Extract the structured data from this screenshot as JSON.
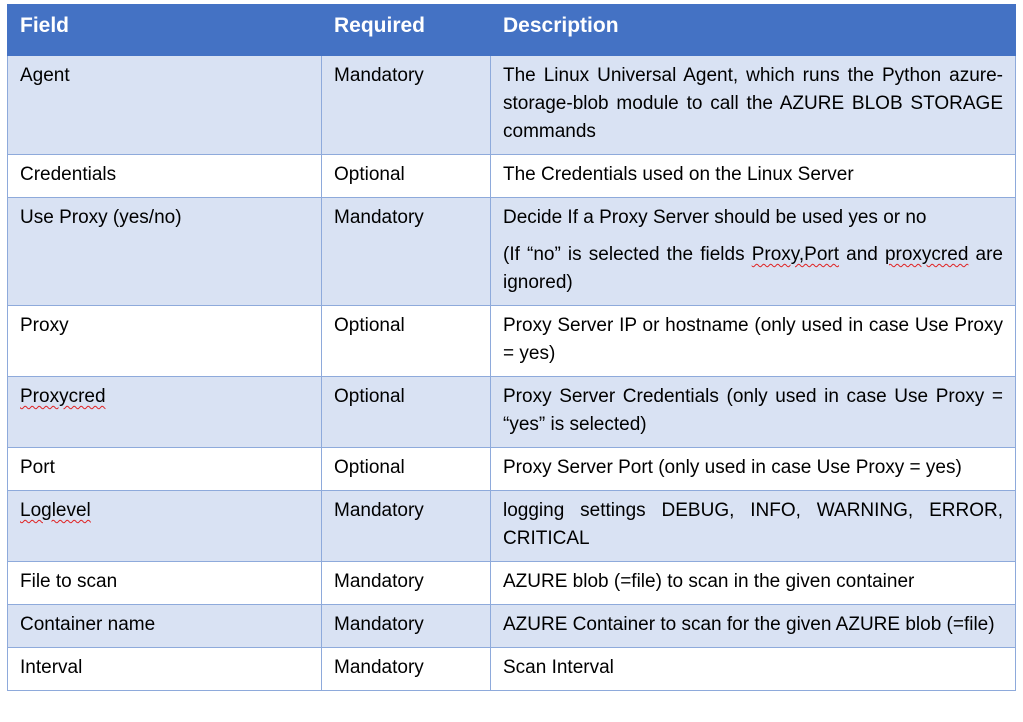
{
  "table": {
    "headers": [
      "Field",
      "Required",
      "Description"
    ],
    "rows": [
      {
        "field": "Agent",
        "required": "Mandatory",
        "description": "The Linux Universal Agent, which runs the Python azure-storage-blob module to call the AZURE BLOB STORAGE commands"
      },
      {
        "field": "Credentials",
        "required": "Optional",
        "description": "The Credentials used on the Linux Server"
      },
      {
        "field": "Use Proxy (yes/no)",
        "required": "Mandatory",
        "description": "Decide If a Proxy Server should be used yes or no",
        "description_note_prefix": "(If “no” is selected the fields ",
        "description_note_flag1": "Proxy,Port",
        "description_note_mid": " and ",
        "description_note_flag2": "proxycred",
        "description_note_suffix": " are ignored)"
      },
      {
        "field": "Proxy",
        "required": "Optional",
        "description": "Proxy Server IP or hostname (only used in case Use Proxy = yes)"
      },
      {
        "field": "Proxycred",
        "required": "Optional",
        "description": "Proxy Server Credentials (only used in case Use Proxy = “yes” is selected)"
      },
      {
        "field": "Port",
        "required": "Optional",
        "description": "Proxy Server Port (only used in case Use Proxy = yes)"
      },
      {
        "field": "Loglevel",
        "required": "Mandatory",
        "description": "logging settings DEBUG, INFO, WARNING, ERROR, CRITICAL"
      },
      {
        "field": "File to scan",
        "required": "Mandatory",
        "description": "AZURE blob (=file) to scan in the given container"
      },
      {
        "field": "Container name",
        "required": "Mandatory",
        "description": "AZURE Container to scan for the given AZURE blob (=file)"
      },
      {
        "field": "Interval",
        "required": "Mandatory",
        "description": "Scan Interval"
      }
    ]
  },
  "colors": {
    "header_bg": "#4472c4",
    "band_bg": "#d9e2f3",
    "border": "#8eaadb",
    "spellcheck_underline": "#e02020"
  }
}
